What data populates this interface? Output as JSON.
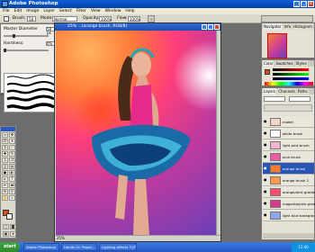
{
  "app": {
    "title": "Adobe Photoshop",
    "menus": [
      "File",
      "Edit",
      "Image",
      "Layer",
      "Select",
      "Filter",
      "View",
      "Window",
      "Help"
    ]
  },
  "options_bar": {
    "brush_label": "Brush:",
    "brush_size": "58",
    "mode_label": "Mode:",
    "mode_value": "Normal",
    "opacity_label": "Opacity:",
    "opacity_value": "100%",
    "flow_label": "Flow:",
    "flow_value": "100%"
  },
  "brush_picker": {
    "master_diameter_label": "Master Diameter",
    "master_diameter_value": "58 px",
    "hardness_label": "Hardness:",
    "hardness_value": "0%"
  },
  "document": {
    "title": "...(orange brush, RGB/8)",
    "zoom": "25%"
  },
  "panels": {
    "navigator_tabs": [
      "Navigator",
      "Info",
      "Histogram"
    ],
    "color_tabs": [
      "Color",
      "Swatches",
      "Styles"
    ],
    "layers_tabs": [
      "Layers",
      "Channels",
      "Paths"
    ],
    "layers": [
      {
        "name": "model",
        "thumb_color": "#f4d4c4",
        "selected": false
      },
      {
        "name": "white brush",
        "thumb_color": "#ffffff",
        "selected": false
      },
      {
        "name": "light pink brush",
        "thumb_color": "#f6b3cf",
        "selected": false
      },
      {
        "name": "pink brush",
        "thumb_color": "#ee5aa6",
        "selected": false
      },
      {
        "name": "orange brush",
        "thumb_color": "#ff7a2e",
        "selected": true
      },
      {
        "name": "orange brush 2",
        "thumb_color": "#ff9a4a",
        "selected": false
      },
      {
        "name": "orange/pink gradient",
        "thumb_color": "#ff4c70",
        "selected": false
      },
      {
        "name": "magenta/pink gradient",
        "thumb_color": "#d63a8c",
        "selected": false
      },
      {
        "name": "light blue background",
        "thumb_color": "#8fa6ee",
        "selected": false
      }
    ]
  },
  "taskbar": {
    "start_label": "start",
    "items": [
      "Adobe Photoshop",
      "Hands On Power...",
      "Lighting effects TUTO..."
    ],
    "clock": "11:40"
  },
  "colors": {
    "foreground": "#d84b1a",
    "background": "#ffffff"
  }
}
